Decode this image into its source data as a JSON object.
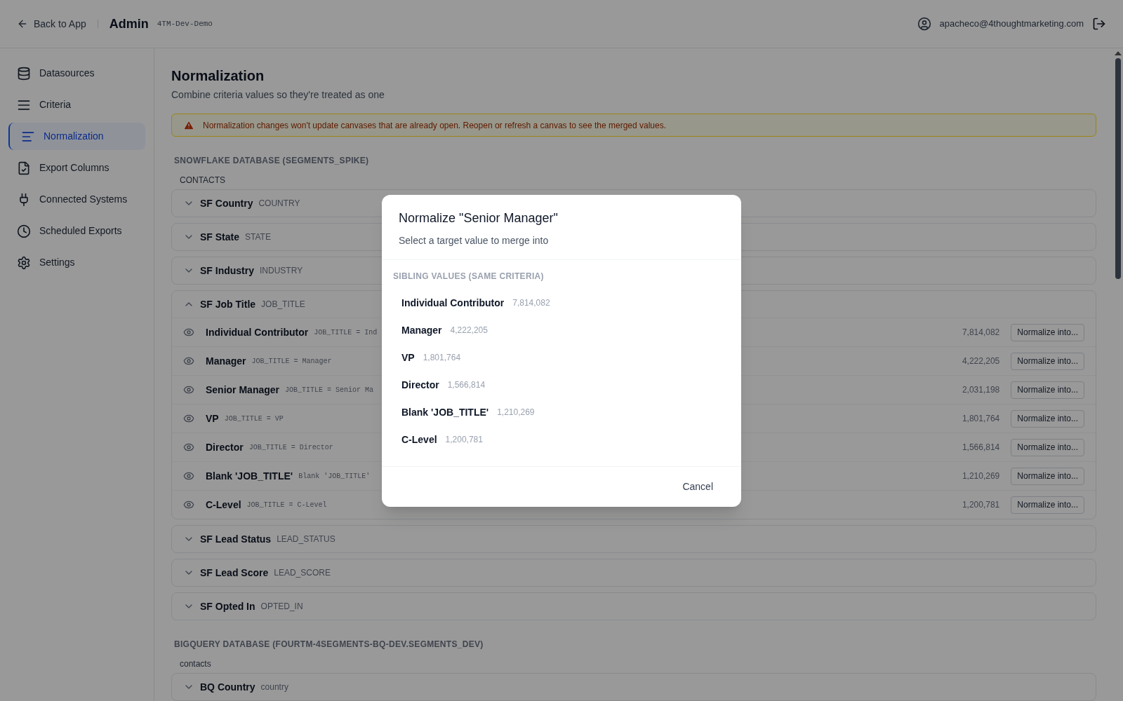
{
  "header": {
    "back_link": "Back to App",
    "title": "Admin",
    "workspace": "4TM-Dev-Demo",
    "user_email": "apacheco@4thoughtmarketing.com"
  },
  "sidebar": {
    "items": [
      {
        "label": "Datasources",
        "selected": false
      },
      {
        "label": "Criteria",
        "selected": false
      },
      {
        "label": "Normalization",
        "selected": true
      },
      {
        "label": "Export Columns",
        "selected": false
      },
      {
        "label": "Connected Systems",
        "selected": false
      },
      {
        "label": "Scheduled Exports",
        "selected": false
      },
      {
        "label": "Settings",
        "selected": false
      }
    ]
  },
  "page": {
    "title": "Normalization",
    "subtitle": "Combine criteria values so they're treated as one",
    "alert": "Normalization changes won't update canvases that are already open. Reopen or refresh a canvas to see the merged values."
  },
  "sections": [
    {
      "heading": "SNOWFLAKE DATABASE (SEGMENTS_SPIKE)",
      "tables": [
        {
          "name": "CONTACTS",
          "criteria": [
            {
              "label": "SF Country",
              "column": "COUNTRY",
              "expanded": false
            },
            {
              "label": "SF State",
              "column": "STATE",
              "expanded": false
            },
            {
              "label": "SF Industry",
              "column": "INDUSTRY",
              "expanded": false
            },
            {
              "label": "SF Job Title",
              "column": "JOB_TITLE",
              "expanded": true,
              "values": [
                {
                  "label": "Individual Contributor",
                  "expression": "JOB_TITLE = Ind",
                  "count": "7,814,082",
                  "action": "Normalize into..."
                },
                {
                  "label": "Manager",
                  "expression": "JOB_TITLE = Manager",
                  "count": "4,222,205",
                  "action": "Normalize into..."
                },
                {
                  "label": "Senior Manager",
                  "expression": "JOB_TITLE = Senior Ma",
                  "count": "2,031,198",
                  "action": "Normalize into..."
                },
                {
                  "label": "VP",
                  "expression": "JOB_TITLE = VP",
                  "count": "1,801,764",
                  "action": "Normalize into..."
                },
                {
                  "label": "Director",
                  "expression": "JOB_TITLE = Director",
                  "count": "1,566,814",
                  "action": "Normalize into..."
                },
                {
                  "label": "Blank 'JOB_TITLE'",
                  "expression": "Blank 'JOB_TITLE'",
                  "count": "1,210,269",
                  "action": "Normalize into..."
                },
                {
                  "label": "C-Level",
                  "expression": "JOB_TITLE = C-Level",
                  "count": "1,200,781",
                  "action": "Normalize into..."
                }
              ]
            },
            {
              "label": "SF Lead Status",
              "column": "LEAD_STATUS",
              "expanded": false
            },
            {
              "label": "SF Lead Score",
              "column": "LEAD_SCORE",
              "expanded": false
            },
            {
              "label": "SF Opted In",
              "column": "OPTED_IN",
              "expanded": false
            }
          ]
        }
      ]
    },
    {
      "heading": "BIGQUERY DATABASE (FOURTM-4SEGMENTS-BQ-DEV.SEGMENTS_DEV)",
      "tables": [
        {
          "name": "contacts",
          "criteria": [
            {
              "label": "BQ Country",
              "column": "country",
              "expanded": false
            }
          ]
        }
      ]
    }
  ],
  "dialog": {
    "title": "Normalize \"Senior Manager\"",
    "subtitle": "Select a target value to merge into",
    "group_heading": "SIBLING VALUES (SAME CRITERIA)",
    "options": [
      {
        "label": "Individual Contributor",
        "count": "7,814,082"
      },
      {
        "label": "Manager",
        "count": "4,222,205"
      },
      {
        "label": "VP",
        "count": "1,801,764"
      },
      {
        "label": "Director",
        "count": "1,566,814"
      },
      {
        "label": "Blank 'JOB_TITLE'",
        "count": "1,210,269"
      },
      {
        "label": "C-Level",
        "count": "1,200,781"
      }
    ],
    "cancel": "Cancel"
  }
}
